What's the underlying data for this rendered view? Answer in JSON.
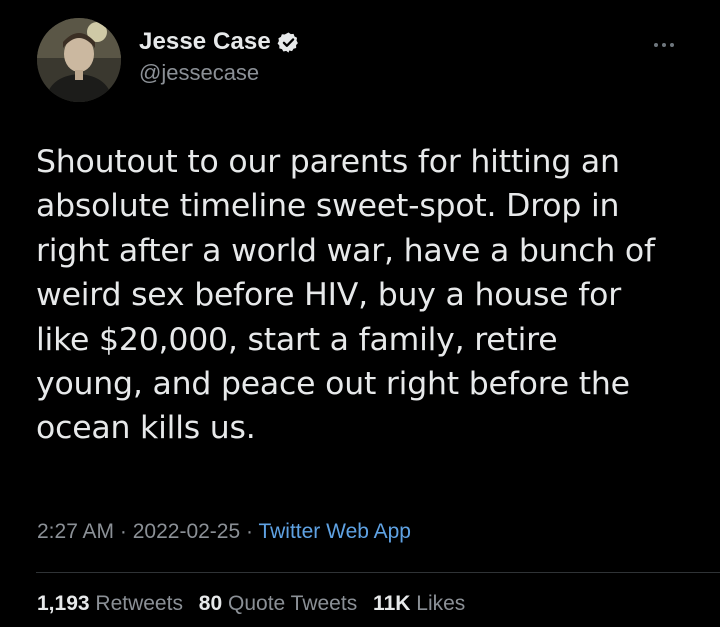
{
  "user": {
    "display_name": "Jesse Case",
    "handle": "@jessecase",
    "verified_icon": "verified-badge-icon"
  },
  "tweet": {
    "lines": [
      "Shoutout to our parents for hitting an",
      "absolute timeline sweet-spot. Drop in",
      "right after a world war, have a bunch of",
      "weird sex before HIV, buy a house for",
      "like $20,000, start a family, retire",
      "young, and peace out right before the",
      "ocean kills us."
    ]
  },
  "meta": {
    "time": "2:27 AM",
    "sep1": " · ",
    "date": "2022-02-25",
    "sep2": " · ",
    "app": "Twitter Web App"
  },
  "stats": {
    "retweets_count": "1,193",
    "retweets_label": "Retweets",
    "quotes_count": "80",
    "quotes_label": "Quote Tweets",
    "likes_count": "11K",
    "likes_label": "Likes"
  },
  "colors": {
    "background": "#000000",
    "text": "#e7e9ea",
    "secondary": "#8b9096",
    "link": "#5fa2e3",
    "verified": "#e7e9ea"
  },
  "icons": {
    "more": "more-options-icon"
  }
}
